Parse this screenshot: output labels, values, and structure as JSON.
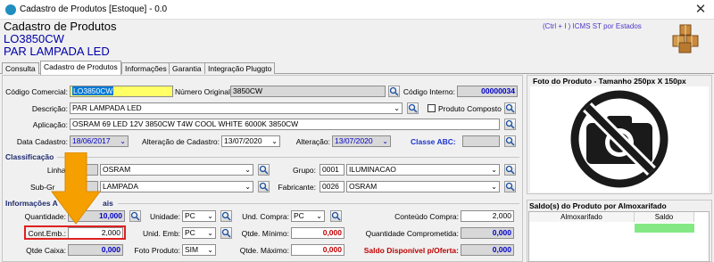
{
  "window": {
    "title": "Cadastro de Produtos [Estoque] - 0.0",
    "close_symbol": "✕"
  },
  "header": {
    "line1": "Cadastro de Produtos",
    "line2": "LO3850CW",
    "line3": "PAR LAMPADA LED",
    "shortcut_hint": "(Ctrl + I ) ICMS ST por Estados"
  },
  "tabs": [
    "Consulta",
    "Cadastro de Produtos",
    "Informações",
    "Garantia",
    "Integração Pluggto"
  ],
  "form": {
    "codigo_comercial_label": "Código Comercial:",
    "codigo_comercial": "LO3850CW",
    "numero_original_label": "Número Original:",
    "numero_original": "3850CW",
    "codigo_interno_label": "Código Interno:",
    "codigo_interno": "00000034",
    "descricao_label": "Descrição:",
    "descricao": "PAR LAMPADA LED",
    "produto_composto_label": "Produto Composto",
    "aplicacao_label": "Aplicação:",
    "aplicacao": "OSRAM 69 LED 12V 3850CW T4W COOL WHITE 6000K 3850CW",
    "data_cadastro_label": "Data Cadastro:",
    "data_cadastro": "18/06/2017",
    "alteracao_cadastro_label": "Alteração de Cadastro:",
    "alteracao_cadastro": "13/07/2020",
    "alteracao_label": "Alteração:",
    "alteracao": "13/07/2020",
    "classe_abc_label": "Classe ABC:"
  },
  "classificacao": {
    "section_label": "Classificação",
    "linha_label": "Linha:",
    "linha": "OSRAM",
    "grupo_label": "Grupo:",
    "grupo_code": "0001",
    "grupo": "ILUMINACAO",
    "subgrupo_label": "Sub-Gr",
    "subgrupo": "LAMPADA",
    "fabricante_label": "Fabricante:",
    "fabricante_code": "0026",
    "fabricante": "OSRAM"
  },
  "informacoes": {
    "section_label_left": "Informações A",
    "section_label_right": "ais",
    "quantidade_label": "Quantidade:",
    "quantidade": "10,000",
    "unidade_label": "Unidade:",
    "unidade": "PC",
    "und_compra_label": "Und. Compra:",
    "und_compra": "PC",
    "conteudo_compra_label": "Conteúdo Compra:",
    "conteudo_compra": "2,000",
    "cont_emb_label": "Cont.Emb.:",
    "cont_emb": "2,000",
    "unid_emb_label": "Unid. Emb:",
    "unid_emb": "PC",
    "qtde_minimo_label": "Qtde. Mínimo:",
    "qtde_minimo": "0,000",
    "quantidade_comprometida_label": "Quantidade Comprometida:",
    "quantidade_comprometida": "0,000",
    "qtde_caixa_label": "Qtde Caixa:",
    "qtde_caixa": "0,000",
    "foto_produto_label": "Foto Produto:",
    "foto_produto": "SIM",
    "qtde_maximo_label": "Qtde. Máximo:",
    "qtde_maximo": "0,000",
    "saldo_disponivel_label": "Saldo Disponível p/Oferta:",
    "saldo_disponivel": "0,000"
  },
  "photo": {
    "title": "Foto do Produto - Tamanho 250px X 150px",
    "icon": "no-photo-icon"
  },
  "saldo": {
    "title": "Saldo(s) do Produto por Almoxarifado",
    "columns": [
      "Almoxarifado",
      "Saldo"
    ]
  },
  "colors": {
    "accent_blue": "#0000c8",
    "alert_red": "#c00000",
    "highlight_red": "#e02020",
    "arrow_orange": "#f5a000",
    "saldo_green": "#84e884"
  }
}
